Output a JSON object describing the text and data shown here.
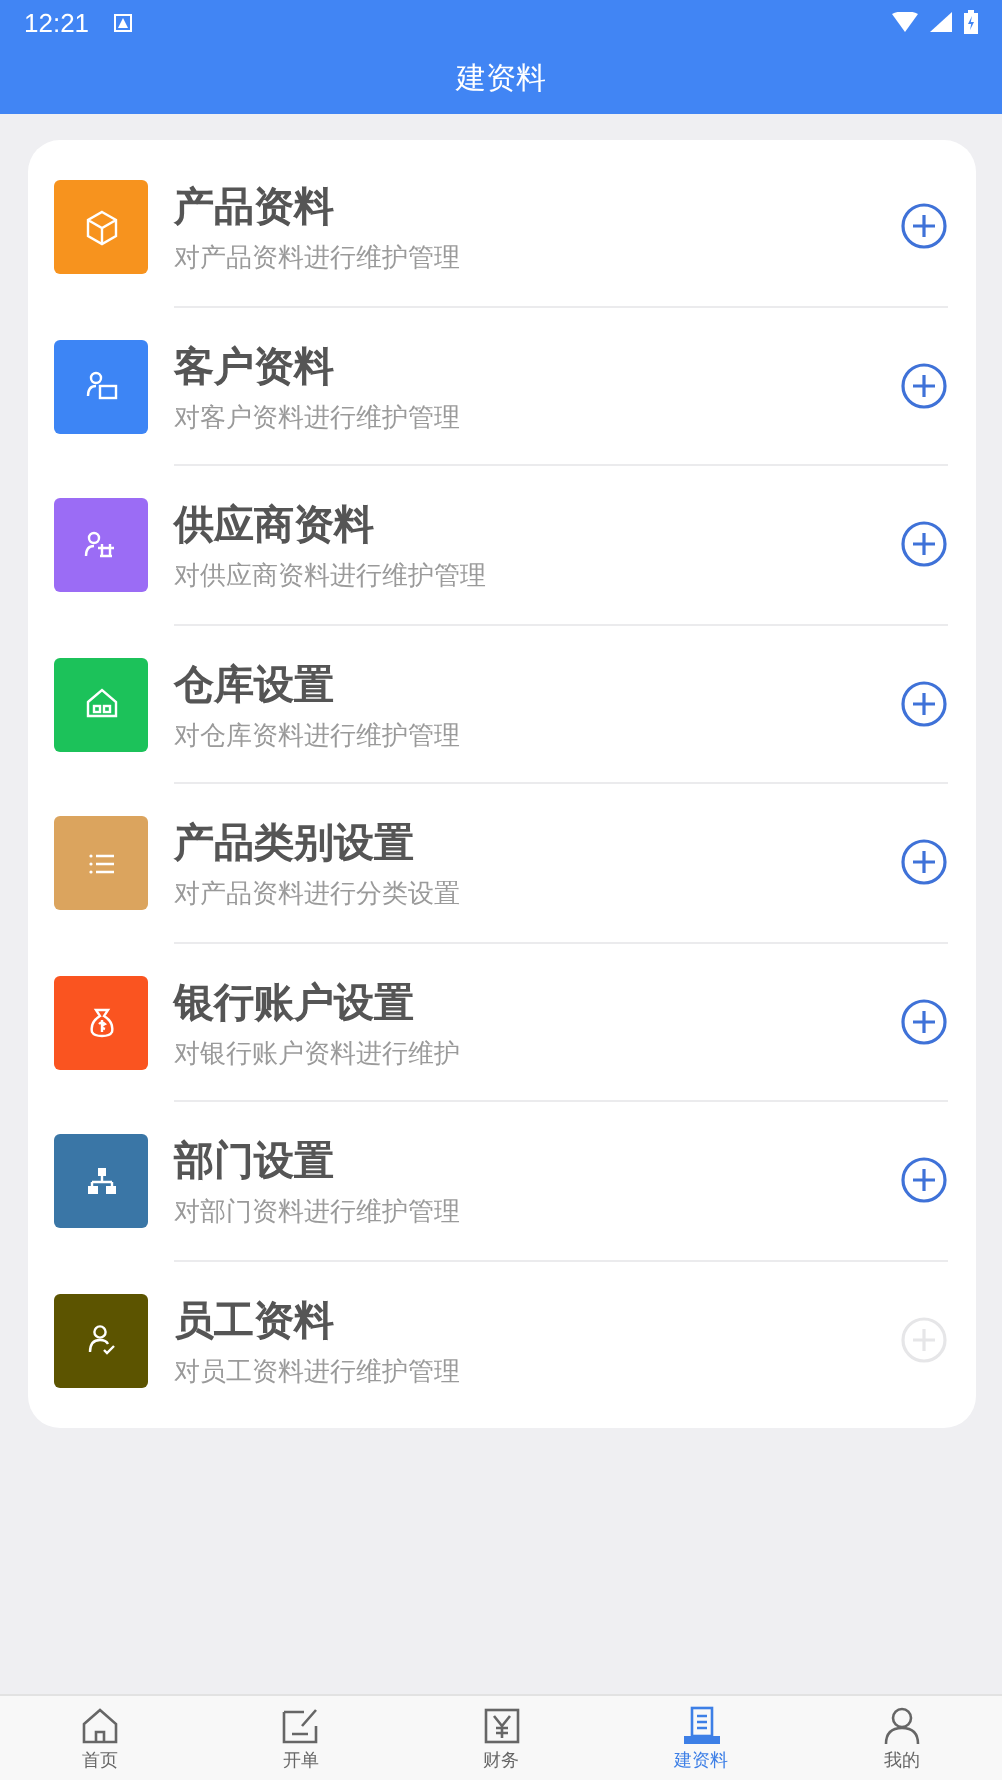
{
  "status_bar": {
    "time": "12:21"
  },
  "header": {
    "title": "建资料"
  },
  "items": [
    {
      "title": "产品资料",
      "subtitle": "对产品资料进行维护管理",
      "color": "#f7931e",
      "disabled": false
    },
    {
      "title": "客户资料",
      "subtitle": "对客户资料进行维护管理",
      "color": "#3d85f5",
      "disabled": false
    },
    {
      "title": "供应商资料",
      "subtitle": "对供应商资料进行维护管理",
      "color": "#9b6cf5",
      "disabled": false
    },
    {
      "title": "仓库设置",
      "subtitle": "对仓库资料进行维护管理",
      "color": "#1cc25a",
      "disabled": false
    },
    {
      "title": "产品类别设置",
      "subtitle": "对产品资料进行分类设置",
      "color": "#dba45e",
      "disabled": false
    },
    {
      "title": "银行账户设置",
      "subtitle": "对银行账户资料进行维护",
      "color": "#fa5420",
      "disabled": false
    },
    {
      "title": "部门设置",
      "subtitle": "对部门资料进行维护管理",
      "color": "#3a76a6",
      "disabled": false
    },
    {
      "title": "员工资料",
      "subtitle": "对员工资料进行维护管理",
      "color": "#5c5400",
      "disabled": true
    }
  ],
  "tabs": [
    {
      "label": "首页",
      "selected": false
    },
    {
      "label": "开单",
      "selected": false
    },
    {
      "label": "财务",
      "selected": false
    },
    {
      "label": "建资料",
      "selected": true
    },
    {
      "label": "我的",
      "selected": false
    }
  ]
}
